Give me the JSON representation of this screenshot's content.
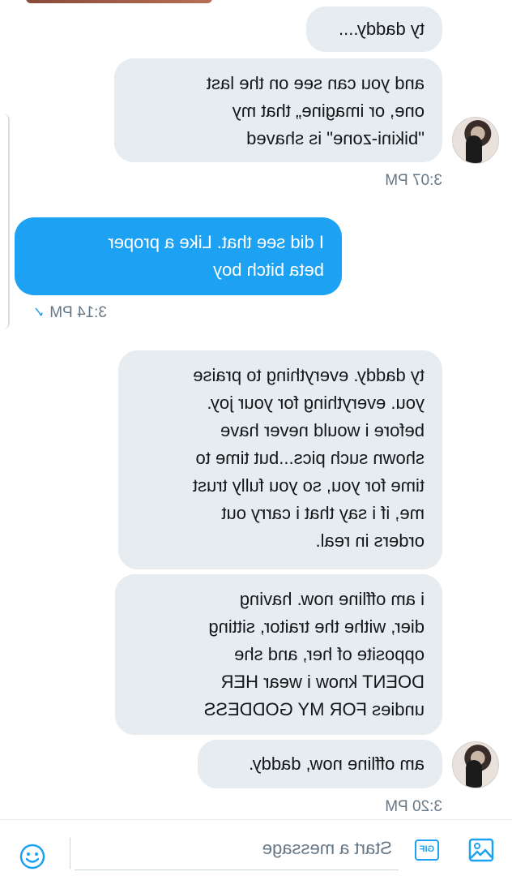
{
  "messages": [
    {
      "text": "ty daddy....",
      "from": "them"
    },
    {
      "text": "and you can see on the last\none, or imagine„ that my\n\"bikini-zone\" is shaved",
      "from": "them"
    },
    {
      "text": "I did see that. Like a proper\nbeta bitch boy",
      "from": "me"
    },
    {
      "text": "ty daddy. everything to praise\nyou. everything for your joy.\nbefore i would never have\nshown such pics...but time to\ntime for you, so you fully trust\nme, if i say that i carry out\norders in real.",
      "from": "them"
    },
    {
      "text": "i am offline now. having\ndier, withe the traitor, sitting\nopposite of her, and she\nDOENT know i wear HER\nundies FOR MY GODDESS",
      "from": "them"
    },
    {
      "text": "am offline now, daddy.",
      "from": "them"
    }
  ],
  "timestamps": [
    "3:07 PM",
    "3:14 PM",
    "3:20 PM"
  ],
  "read_receipt_icon": "check-icon",
  "composer": {
    "placeholder": "Start a message",
    "gif_label": "GIF"
  },
  "colors": {
    "sent_bubble": "#1da1f2",
    "received_bubble": "#e6ecf0",
    "timestamp": "#657786"
  }
}
